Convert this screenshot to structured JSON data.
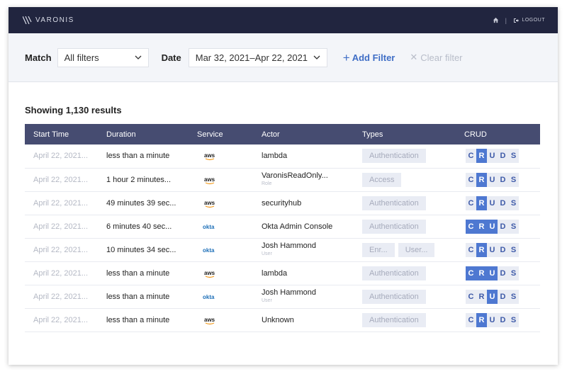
{
  "header": {
    "logo_text": "VARONIS",
    "logout_label": "LOGOUT",
    "separator": "|"
  },
  "filters": {
    "match_label": "Match",
    "match_value": "All filters",
    "date_label": "Date",
    "date_value": "Mar 32, 2021–Apr 22, 2021",
    "add_filter_label": "Add Filter",
    "clear_filter_label": "Clear filter"
  },
  "results_text": "Showing 1,130 results",
  "table": {
    "headers": [
      "Start Time",
      "Duration",
      "Service",
      "Actor",
      "Types",
      "CRUD"
    ],
    "crud_letters": [
      "C",
      "R",
      "U",
      "D",
      "S"
    ],
    "rows": [
      {
        "start": "April 22, 2021...",
        "duration": "less than a minute",
        "service": "aws",
        "actor": "lambda",
        "actor_sub": "",
        "types": [
          "Authentication"
        ],
        "crud_active": [
          "R"
        ]
      },
      {
        "start": "April 22, 2021...",
        "duration": "1 hour 2 minutes...",
        "service": "aws",
        "actor": "VaronisReadOnly...",
        "actor_sub": "Role",
        "types": [
          "Access"
        ],
        "crud_active": [
          "R"
        ]
      },
      {
        "start": "April 22, 2021...",
        "duration": "49 minutes 39 sec...",
        "service": "aws",
        "actor": "securityhub",
        "actor_sub": "",
        "types": [
          "Authentication"
        ],
        "crud_active": [
          "R"
        ]
      },
      {
        "start": "April 22, 2021...",
        "duration": "6 minutes 40 sec...",
        "service": "okta",
        "actor": "Okta Admin Console",
        "actor_sub": "",
        "types": [
          "Authentication"
        ],
        "crud_active": [
          "C",
          "R",
          "U"
        ]
      },
      {
        "start": "April 22, 2021...",
        "duration": "10 minutes 34 sec...",
        "service": "okta",
        "actor": "Josh Hammond",
        "actor_sub": "User",
        "types": [
          "Enr...",
          "User..."
        ],
        "crud_active": [
          "R"
        ]
      },
      {
        "start": "April 22, 2021...",
        "duration": "less than a minute",
        "service": "aws",
        "actor": "lambda",
        "actor_sub": "",
        "types": [
          "Authentication"
        ],
        "crud_active": [
          "C",
          "R",
          "U"
        ]
      },
      {
        "start": "April 22, 2021...",
        "duration": "less than a minute",
        "service": "okta",
        "actor": "Josh Hammond",
        "actor_sub": "User",
        "types": [
          "Authentication"
        ],
        "crud_active": [
          "U"
        ]
      },
      {
        "start": "April 22, 2021...",
        "duration": "less than a minute",
        "service": "aws",
        "actor": "Unknown",
        "actor_sub": "",
        "types": [
          "Authentication"
        ],
        "crud_active": [
          "R"
        ]
      }
    ]
  },
  "colors": {
    "topbar": "#21253f",
    "table_header": "#464c71",
    "accent": "#4e78d1",
    "tag_bg": "#e9ecf4"
  }
}
